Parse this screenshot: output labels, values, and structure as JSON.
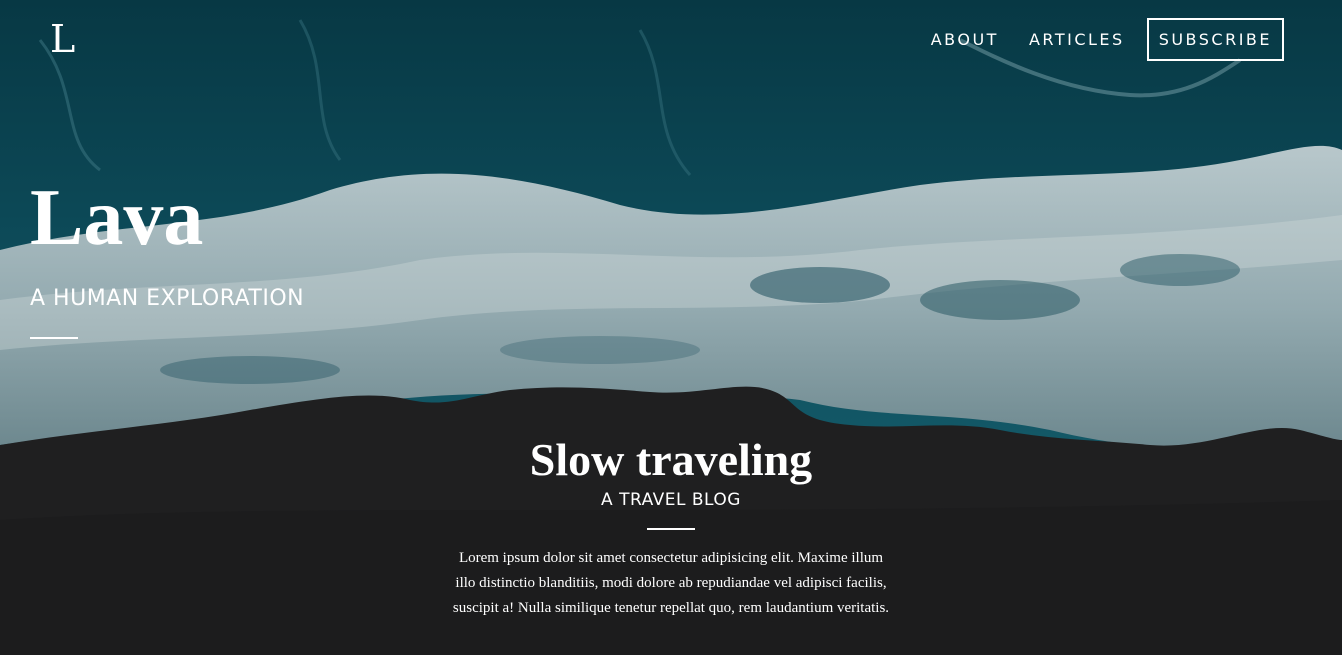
{
  "header": {
    "logo": "L",
    "nav": [
      {
        "label": "ABOUT"
      },
      {
        "label": "ARTICLES"
      },
      {
        "label": "SUBSCRIBE"
      }
    ]
  },
  "hero": {
    "title": "Lava",
    "subtitle": "A HUMAN EXPLORATION"
  },
  "post": {
    "title": "Slow traveling",
    "subtitle": "A TRAVEL BLOG",
    "body": "Lorem ipsum dolor sit amet consectetur adipisicing elit. Maxime illum illo distinctio blanditiis, modi dolore ab repudiandae vel adipisci facilis, suscipit a! Nulla similique tenetur repellat quo, rem laudantium veritatis."
  },
  "colors": {
    "ocean": "#0b4250",
    "foam": "#a9babf",
    "sand": "#1e1e1f",
    "text": "#ffffff"
  }
}
